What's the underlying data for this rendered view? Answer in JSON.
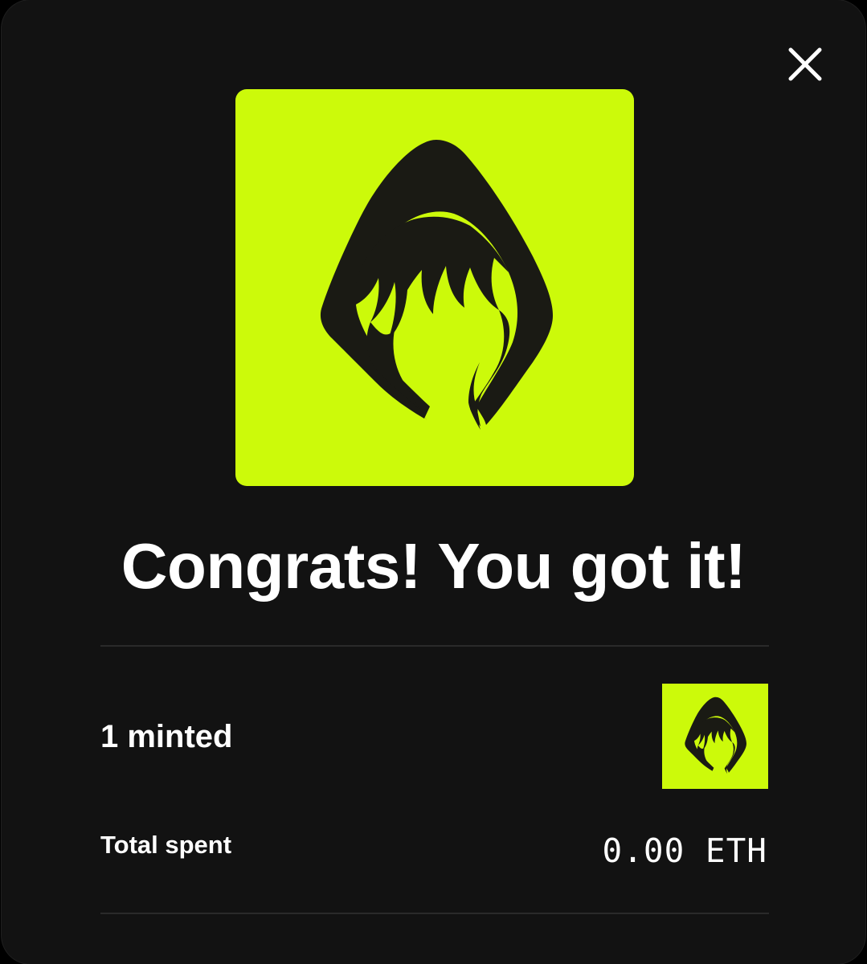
{
  "colors": {
    "background": "#121212",
    "accent": "#ccfa0a",
    "text": "#ffffff",
    "divider": "#2a2a2a",
    "artwork": "#1a1a14"
  },
  "close_icon": "close-icon",
  "hero": {
    "artwork": "hooded-figure-artwork"
  },
  "headline": "Congrats! You got it!",
  "summary": {
    "minted_label": "1 minted",
    "thumbnail": "hooded-figure-thumbnail",
    "total_spent_label": "Total spent",
    "total_spent_value": "0.00 ETH"
  }
}
